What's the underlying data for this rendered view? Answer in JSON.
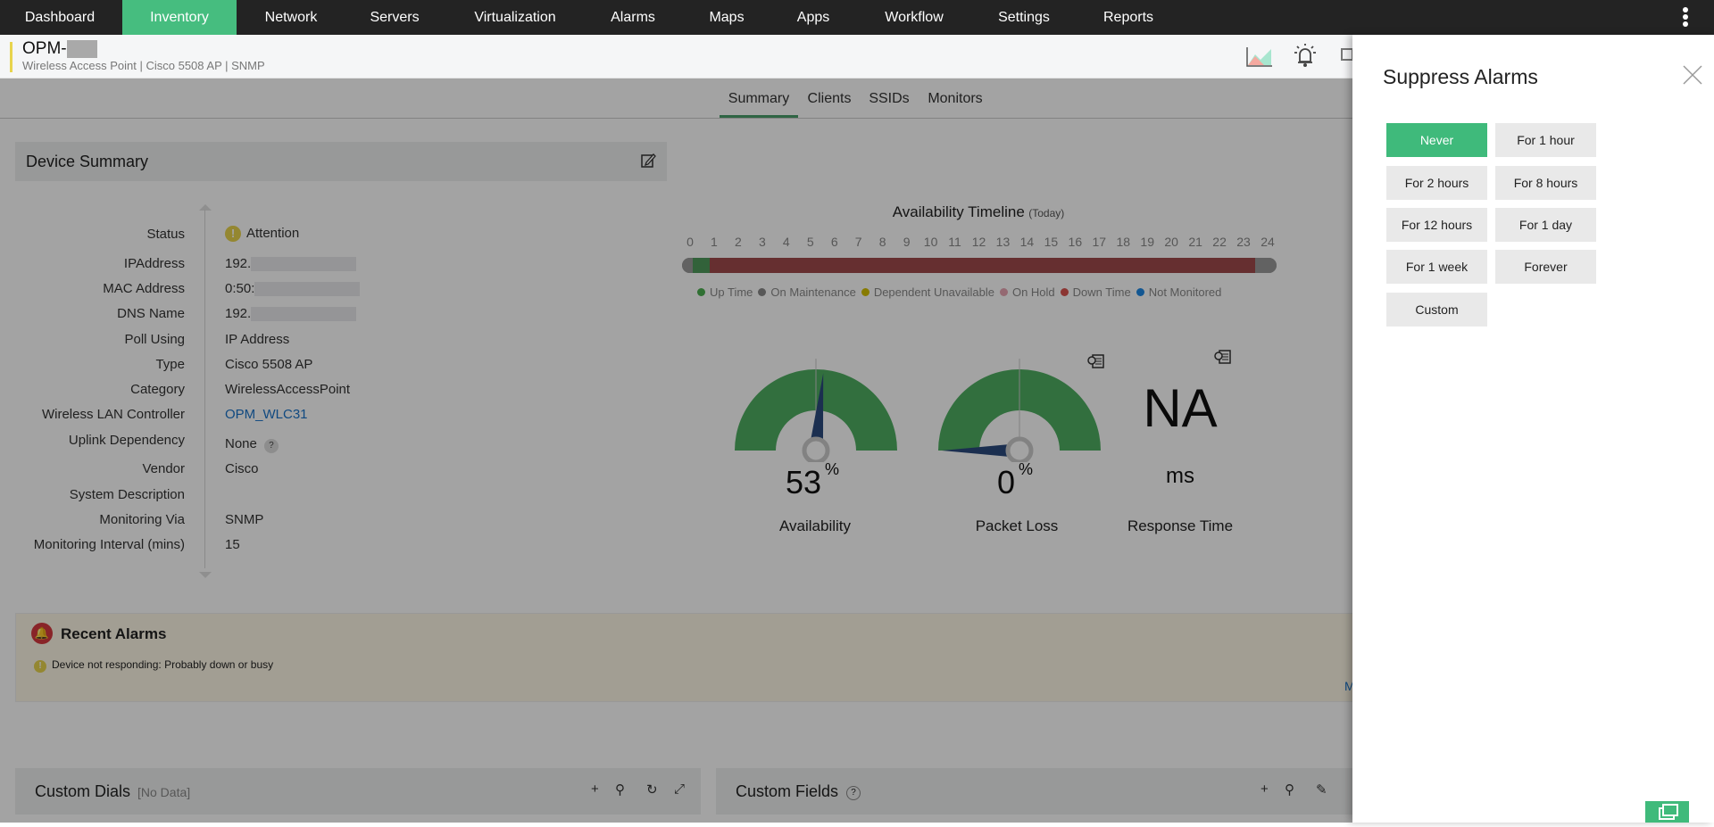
{
  "nav": {
    "items": [
      "Dashboard",
      "Inventory",
      "Network",
      "Servers",
      "Virtualization",
      "Alarms",
      "Maps",
      "Apps",
      "Workflow",
      "Settings",
      "Reports"
    ],
    "active": "Inventory"
  },
  "header": {
    "title": "OPM-",
    "subtitle": "Wireless Access Point | Cisco 5508 AP  | SNMP"
  },
  "tabs": [
    "Summary",
    "Clients",
    "SSIDs",
    "Monitors"
  ],
  "device_summary": {
    "title": "Device Summary",
    "rows": [
      {
        "label": "Status",
        "value": "Attention"
      },
      {
        "label": "IPAddress",
        "value": "192."
      },
      {
        "label": "MAC Address",
        "value": "0:50:"
      },
      {
        "label": "DNS Name",
        "value": "192."
      },
      {
        "label": "Poll Using",
        "value": "IP Address"
      },
      {
        "label": "Type",
        "value": "Cisco 5508 AP"
      },
      {
        "label": "Category",
        "value": "WirelessAccessPoint"
      },
      {
        "label": "Wireless LAN Controller",
        "value": "OPM_WLC31"
      },
      {
        "label": "Uplink Dependency",
        "value": "None"
      },
      {
        "label": "Vendor",
        "value": "Cisco"
      },
      {
        "label": "System Description",
        "value": ""
      },
      {
        "label": "Monitoring Via",
        "value": "SNMP"
      },
      {
        "label": "Monitoring Interval (mins)",
        "value": "15"
      }
    ],
    "help_glyph": "?"
  },
  "timeline": {
    "title": "Availability Timeline",
    "subtitle": "(Today)",
    "hours": [
      "0",
      "1",
      "2",
      "3",
      "4",
      "5",
      "6",
      "7",
      "8",
      "9",
      "10",
      "11",
      "12",
      "13",
      "14",
      "15",
      "16",
      "17",
      "18",
      "19",
      "20",
      "21",
      "22",
      "23",
      "24"
    ],
    "segments": [
      {
        "state": "Not Monitored (gray)",
        "from": 0,
        "to": 0.1,
        "color": "#999999"
      },
      {
        "state": "Up Time",
        "from": 0.1,
        "to": 0.8,
        "color": "#4f9a5c"
      },
      {
        "state": "Down Time",
        "from": 0.8,
        "to": 23.4,
        "color": "#a04a4c"
      },
      {
        "state": "gray",
        "from": 23.4,
        "to": 24,
        "color": "#999999"
      }
    ],
    "legend": [
      {
        "label": "Up Time",
        "color": "#4caf50"
      },
      {
        "label": "On Maintenance",
        "color": "#888888"
      },
      {
        "label": "Dependent Unavailable",
        "color": "#d4c000"
      },
      {
        "label": "On Hold",
        "color": "#e8a5b3"
      },
      {
        "label": "Down Time",
        "color": "#d9534f"
      },
      {
        "label": "Not Monitored",
        "color": "#1e88e5"
      }
    ]
  },
  "gauges": [
    {
      "label": "Availability",
      "value": "53",
      "unit": "%",
      "percent": 53
    },
    {
      "label": "Packet Loss",
      "value": "0",
      "unit": "%",
      "percent": 0
    }
  ],
  "response_time": {
    "value": "NA",
    "unit": "ms",
    "label": "Response Time"
  },
  "recent_alarms": {
    "title": "Recent Alarms",
    "items": [
      "Device not responding: Probably down or busy"
    ],
    "more_link": "M"
  },
  "custom_dials": {
    "title": "Custom Dials",
    "note": "[No Data]"
  },
  "custom_fields": {
    "title": "Custom Fields",
    "help": "?"
  },
  "suppress": {
    "title": "Suppress Alarms",
    "options": [
      "Never",
      "For 1 hour",
      "For 2 hours",
      "For 8 hours",
      "For 12 hours",
      "For 1 day",
      "For 1 week",
      "Forever",
      "Custom"
    ],
    "selected": "Never"
  },
  "colors": {
    "accent": "#46bd7f",
    "nav_bg": "#232323",
    "link": "#1a73c9"
  }
}
